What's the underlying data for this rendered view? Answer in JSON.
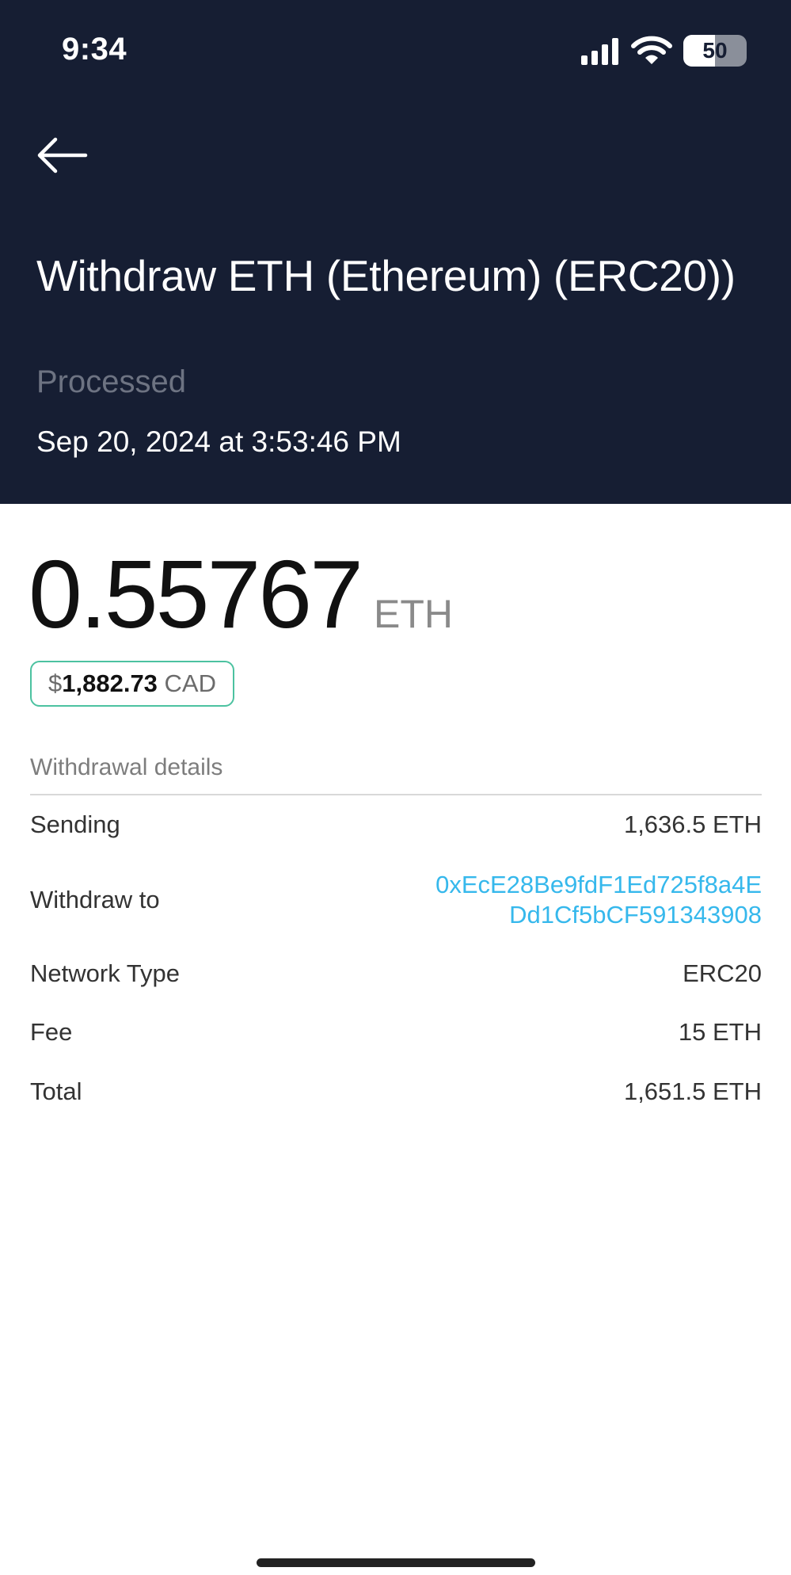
{
  "status_bar": {
    "time": "9:34",
    "battery": "50",
    "battery_level": 0.5
  },
  "header": {
    "title": "Withdraw ETH (Ethereum) (ERC20))",
    "status": "Processed",
    "timestamp": "Sep 20, 2024 at 3:53:46 PM",
    "background_color": "#161e33"
  },
  "amount": {
    "value": "0.55767",
    "unit": "ETH",
    "fiat_symbol": "$",
    "fiat_value": "1,882.73",
    "fiat_currency": "CAD",
    "pill_border_color": "#4cc2a0"
  },
  "details": {
    "section_title": "Withdrawal details",
    "sending_label": "Sending",
    "sending_value": "1,636.5 ETH",
    "withdraw_to_label": "Withdraw to",
    "withdraw_to_line1": "0xEcE28Be9fdF1Ed725f8a4E",
    "withdraw_to_line2": "Dd1Cf5bCF591343908",
    "network_label": "Network Type",
    "network_value": "ERC20",
    "fee_label": "Fee",
    "fee_value": "15 ETH",
    "total_label": "Total",
    "total_value": "1,651.5 ETH",
    "link_color": "#36b8ec"
  },
  "icons": {
    "back": "arrow-left-icon",
    "signal": "cellular-signal-icon",
    "wifi": "wifi-icon",
    "battery": "battery-icon"
  }
}
